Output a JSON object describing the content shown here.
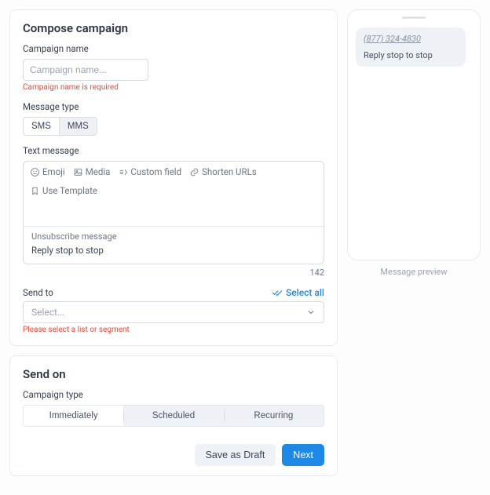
{
  "compose": {
    "title": "Compose campaign",
    "campaign_name": {
      "label": "Campaign name",
      "placeholder": "Campaign name...",
      "error": "Campaign name is required"
    },
    "message_type": {
      "label": "Message type",
      "options": [
        "SMS",
        "MMS"
      ],
      "active": "MMS"
    },
    "text_message": {
      "label": "Text message",
      "tools": {
        "emoji": "Emoji",
        "media": "Media",
        "custom_field": "Custom field",
        "shorten_urls": "Shorten URLs",
        "use_template": "Use Template"
      },
      "unsubscribe_label": "Unsubscribe message",
      "unsubscribe_text": "Reply stop to stop",
      "char_count": "142"
    },
    "send_to": {
      "label": "Send to",
      "select_all": "Select all",
      "placeholder": "Select...",
      "error": "Please select a list or segment"
    }
  },
  "send_on": {
    "title": "Send on",
    "campaign_type_label": "Campaign type",
    "tabs": {
      "immediately": "Immediately",
      "scheduled": "Scheduled",
      "recurring": "Recurring"
    },
    "active_tab": "Immediately",
    "save_draft": "Save as Draft",
    "next": "Next"
  },
  "preview": {
    "phone": "(877) 324-4830",
    "body": "Reply stop to stop",
    "caption": "Message preview"
  }
}
